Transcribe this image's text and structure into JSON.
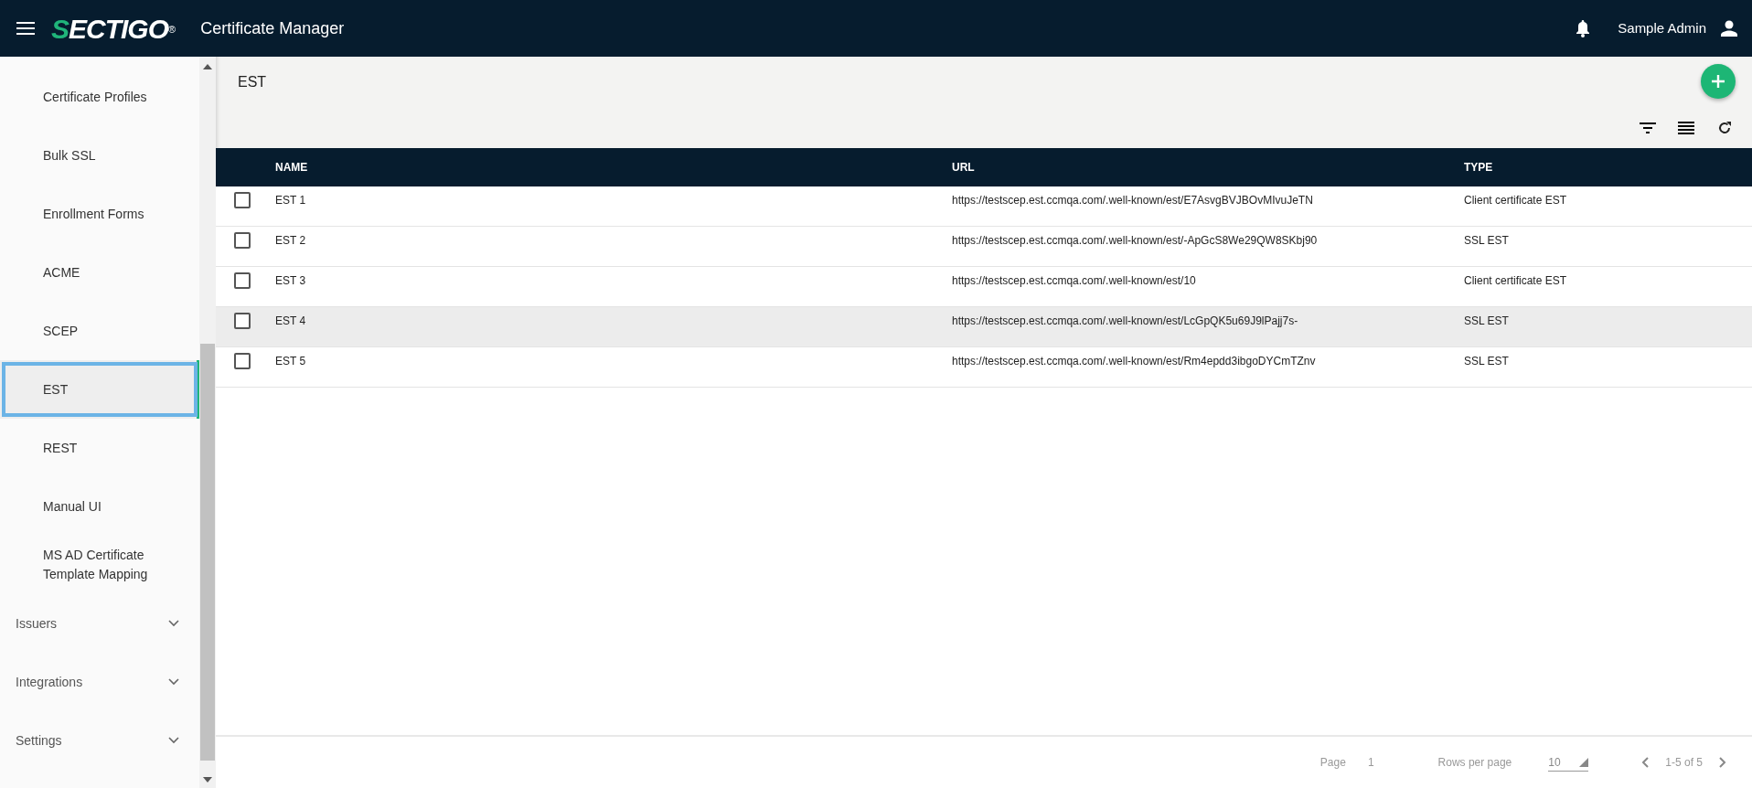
{
  "header": {
    "brand": "SECTIGO",
    "brand_mark": "®",
    "title": "Certificate Manager",
    "user": "Sample Admin"
  },
  "sidebar": {
    "items": [
      {
        "label": "Certificate Profiles",
        "kind": "sub",
        "selected": false
      },
      {
        "label": "Bulk SSL",
        "kind": "sub",
        "selected": false
      },
      {
        "label": "Enrollment Forms",
        "kind": "sub",
        "selected": false
      },
      {
        "label": "ACME",
        "kind": "sub",
        "selected": false
      },
      {
        "label": "SCEP",
        "kind": "sub",
        "selected": false
      },
      {
        "label": "EST",
        "kind": "sub",
        "selected": true
      },
      {
        "label": "REST",
        "kind": "sub",
        "selected": false
      },
      {
        "label": "Manual UI",
        "kind": "sub",
        "selected": false
      },
      {
        "label": "MS AD Certificate Template Mapping",
        "kind": "sub",
        "selected": false
      },
      {
        "label": "Issuers",
        "kind": "group",
        "expanded": false
      },
      {
        "label": "Integrations",
        "kind": "group",
        "expanded": false
      },
      {
        "label": "Settings",
        "kind": "group",
        "expanded": false
      }
    ]
  },
  "page": {
    "title": "EST"
  },
  "table": {
    "columns": [
      "NAME",
      "URL",
      "TYPE"
    ],
    "rows": [
      {
        "name": "EST 1",
        "url": "https://testscep.est.ccmqa.com/.well-known/est/E7AsvgBVJBOvMIvuJeTN",
        "type": "Client certificate EST",
        "checked": false,
        "hovered": false
      },
      {
        "name": "EST 2",
        "url": "https://testscep.est.ccmqa.com/.well-known/est/-ApGcS8We29QW8SKbj90",
        "type": "SSL EST",
        "checked": false,
        "hovered": false
      },
      {
        "name": "EST 3",
        "url": "https://testscep.est.ccmqa.com/.well-known/est/10",
        "type": "Client certificate EST",
        "checked": false,
        "hovered": false
      },
      {
        "name": "EST 4",
        "url": "https://testscep.est.ccmqa.com/.well-known/est/LcGpQK5u69J9lPajj7s-",
        "type": "SSL EST",
        "checked": false,
        "hovered": true
      },
      {
        "name": "EST 5",
        "url": "https://testscep.est.ccmqa.com/.well-known/est/Rm4epdd3ibgoDYCmTZnv",
        "type": "SSL EST",
        "checked": false,
        "hovered": false
      }
    ]
  },
  "pagination": {
    "page_label": "Page",
    "page": "1",
    "rows_label": "Rows per page",
    "rows_value": "10",
    "range": "1-5 of 5"
  }
}
